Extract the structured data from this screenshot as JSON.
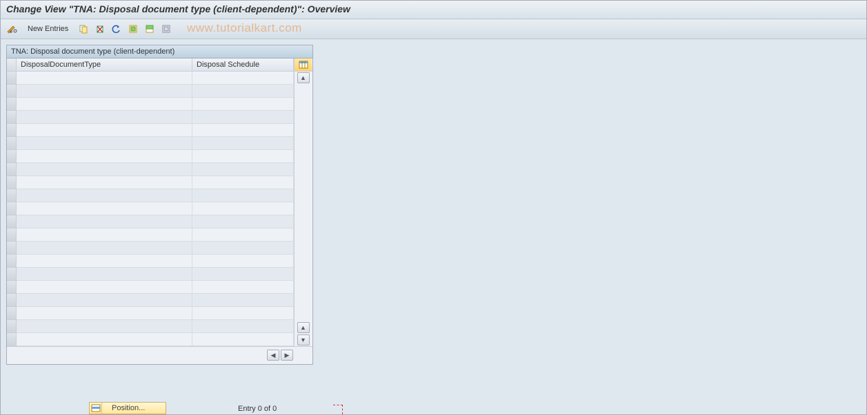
{
  "title": "Change View \"TNA: Disposal document type (client-dependent)\": Overview",
  "toolbar": {
    "new_entries_label": "New Entries"
  },
  "watermark": "www.tutorialkart.com",
  "panel": {
    "title": "TNA: Disposal document type (client-dependent)",
    "columns": {
      "a": "DisposalDocumentType",
      "b": "Disposal Schedule"
    },
    "row_count": 21
  },
  "footer": {
    "position_label": "Position...",
    "entry_text": "Entry 0 of 0"
  }
}
